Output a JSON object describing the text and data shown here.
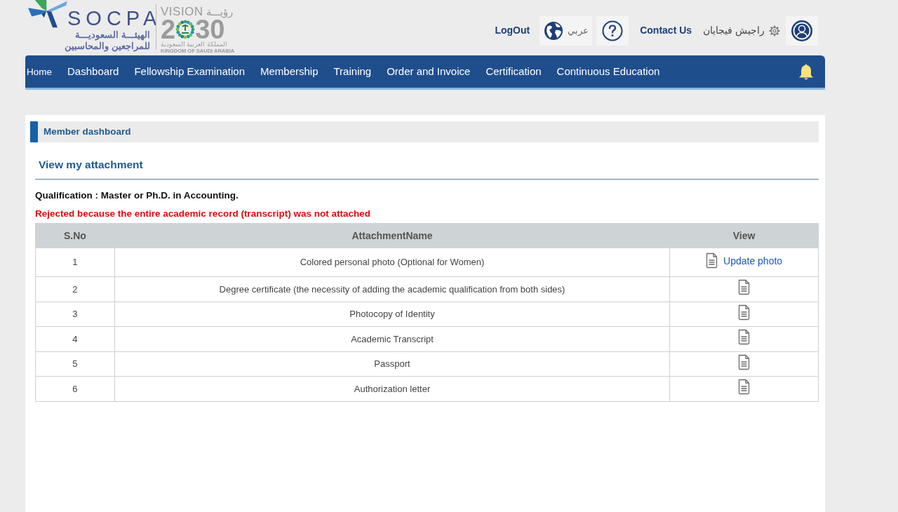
{
  "header": {
    "socpa_logo": {
      "name": "SOCPA",
      "arabic_lines": [
        "الهيئـــة السعوديـــة",
        "للمراجعين والمحاسبين"
      ]
    },
    "vision_logo": {
      "word": "VISION",
      "arabic_word": "رؤيـــة",
      "year_start": "2",
      "year_end": "30",
      "arabic_caption": "المملكة العربية السعودية",
      "caption": "KINGDOM OF SAUDI ARABIA"
    },
    "logout": "LogOut",
    "language": "عربي",
    "contact": "Contact Us",
    "user_name": "راجيش فيجايان"
  },
  "nav": {
    "items": [
      "Home",
      "Dashboard",
      "Fellowship Examination",
      "Membership",
      "Training",
      "Order and Invoice",
      "Certification",
      "Continuous Education"
    ]
  },
  "panel_title": "Member dashboard",
  "section": {
    "title": "View my attachment",
    "qualification": "Qualification : Master or Ph.D. in Accounting.",
    "rejection": "Rejected because the entire academic record (transcript) was not attached"
  },
  "table": {
    "columns": [
      "S.No",
      "AttachmentName",
      "View"
    ],
    "rows": [
      {
        "number": "1",
        "name": "Colored personal photo (Optional for Women)",
        "link": "Update photo"
      },
      {
        "number": "2",
        "name": "Degree certificate (the necessity of adding the academic qualification from both sides)"
      },
      {
        "number": "3",
        "name": "Photocopy of Identity"
      },
      {
        "number": "4",
        "name": "Academic Transcript"
      },
      {
        "number": "5",
        "name": "Passport"
      },
      {
        "number": "6",
        "name": "Authorization letter"
      }
    ]
  }
}
